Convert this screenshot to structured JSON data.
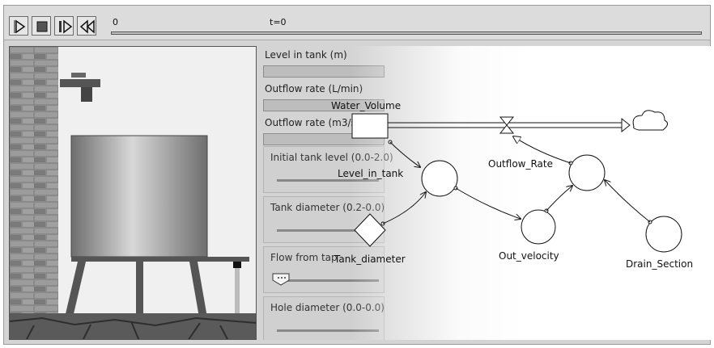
{
  "toolbar": {
    "buttons": [
      {
        "name": "play",
        "icon": "play-icon"
      },
      {
        "name": "stop",
        "icon": "stop-icon"
      },
      {
        "name": "step",
        "icon": "step-forward-icon"
      },
      {
        "name": "rewind",
        "icon": "rewind-icon"
      }
    ],
    "timeline_start": "0",
    "time_label": "t=0",
    "time_progress": 0
  },
  "panel": {
    "outputs": [
      {
        "label": "Level in tank (m)"
      },
      {
        "label": "Outflow rate (L/min)"
      },
      {
        "label": "Outflow rate (m3/s)"
      }
    ],
    "sliders": [
      {
        "label": "Initial tank level (0.0-2.0)"
      },
      {
        "label": "Tank diameter (0.2-0.0)"
      },
      {
        "label": "Flow from tap"
      },
      {
        "label": "Hole diameter (0.0-0.0)"
      }
    ]
  },
  "diagram": {
    "stock": "Water_Volume",
    "flow": "Outflow_Rate",
    "aux": [
      "Level_in_tank",
      "Out_velocity",
      "Drain_Section"
    ],
    "constant": "Tank_diameter"
  },
  "colors": {
    "toolbar_bg": "#dcdcdc",
    "brick": "#8a8a8a",
    "tank_gradient_light": "#d8d8d8",
    "tank_gradient_dark": "#6e6e6e"
  }
}
